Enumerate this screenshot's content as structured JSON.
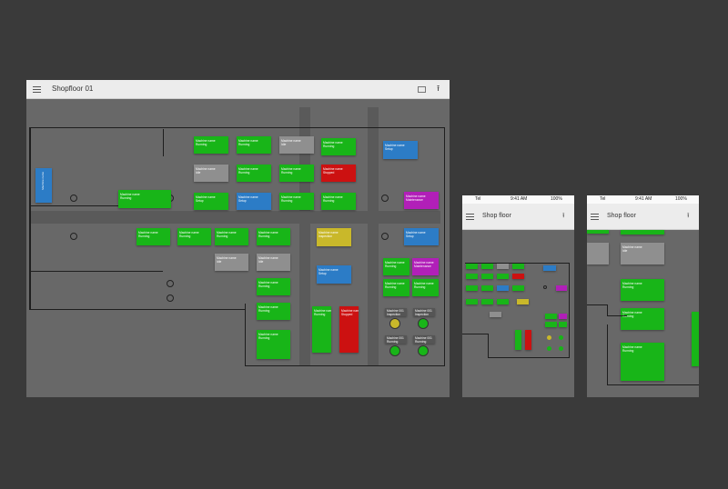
{
  "colors": {
    "running": "#18b518",
    "idle": "#8f8f8f",
    "setup": "#2c7cc6",
    "stopped": "#cc1111",
    "maintenance": "#b11fb8",
    "inspection": "#c9b82a",
    "background": "#3a3a3a",
    "floor": "#686868",
    "appbar": "#ececec"
  },
  "desktop": {
    "title": "Shopfloor 01"
  },
  "phone": {
    "title": "Shop floor",
    "carrier": "Tel",
    "time": "9:41 AM",
    "battery": "100%"
  },
  "labels": {
    "machine_name": "Machine name",
    "machine_001": "Machine 001",
    "running": "Running",
    "idle": "Idle",
    "setup": "Setup",
    "stopped": "Stopped",
    "maintenance": "Maintenance",
    "inspection": "Inspection"
  },
  "icons": {
    "menu": "hamburger-icon",
    "fullscreen": "square-icon",
    "upload": "upload-icon"
  }
}
